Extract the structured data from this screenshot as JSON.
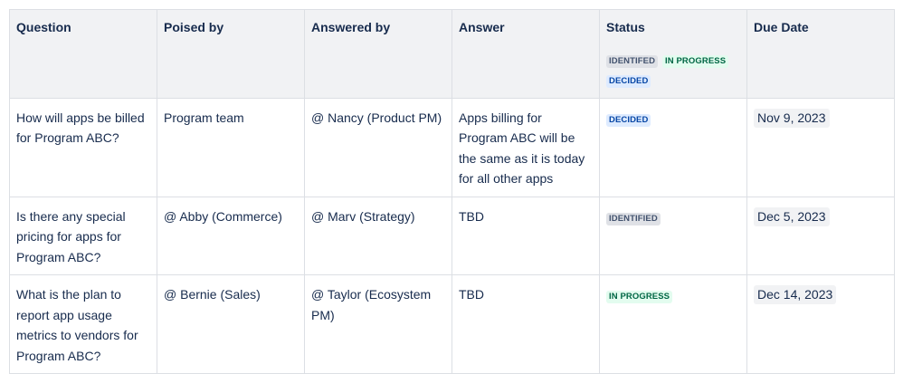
{
  "headers": {
    "question": "Question",
    "poised_by": "Poised by",
    "answered_by": "Answered by",
    "answer": "Answer",
    "status": "Status",
    "due_date": "Due Date"
  },
  "status_legend": {
    "identified": "IDENTIFED",
    "in_progress": "IN PROGRESS",
    "decided": "DECIDED"
  },
  "rows": [
    {
      "question": "How will apps be billed for Program ABC?",
      "poised_by": "Program team",
      "answered_by": "@ Nancy (Product PM)",
      "answer": "Apps billing for Program ABC will be the same as it is today for all other apps",
      "status": "DECIDED",
      "due_date": "Nov 9, 2023"
    },
    {
      "question": "Is there any special pricing for apps for Program ABC?",
      "poised_by": "@ Abby (Commerce)",
      "answered_by": "@ Marv (Strategy)",
      "answer": "TBD",
      "status": "IDENTIFIED",
      "due_date": "Dec 5, 2023"
    },
    {
      "question": "What is the plan to report app usage metrics to vendors for Program ABC?",
      "poised_by": "@ Bernie (Sales)",
      "answered_by": "@ Taylor (Ecosystem PM)",
      "answer": "TBD",
      "status": "IN PROGRESS",
      "due_date": "Dec 14, 2023"
    }
  ],
  "colors": {
    "header_bg": "#f1f2f4",
    "border": "#dcdfe4",
    "text": "#172b4d",
    "identified_bg": "#dfe1e6",
    "identified_fg": "#42526e",
    "in_progress_bg": "#e3fcef",
    "in_progress_fg": "#006644",
    "decided_bg": "#deebff",
    "decided_fg": "#0747a6"
  }
}
